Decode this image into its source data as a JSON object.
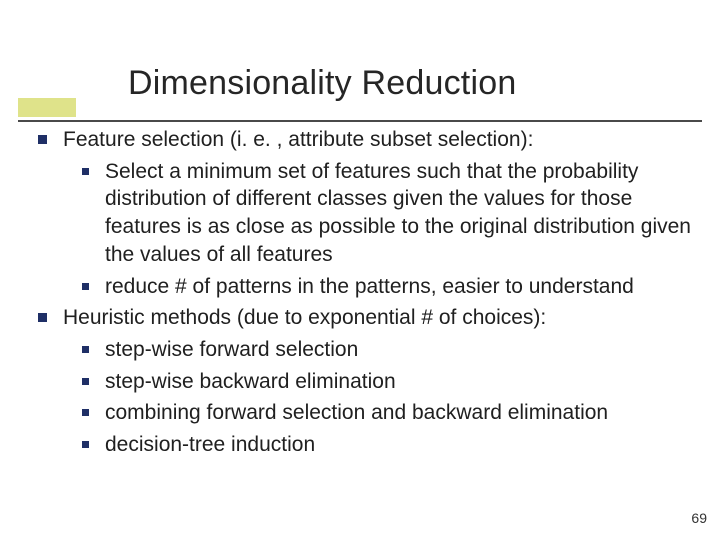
{
  "slide": {
    "title": "Dimensionality Reduction",
    "page_number": "69",
    "items": [
      {
        "text": "Feature selection (i. e. , attribute subset selection):",
        "sub": [
          "Select a minimum set of features such that the probability distribution of different classes given the values for those features is as close as possible to the original distribution given the values of all features",
          "reduce # of patterns in the patterns, easier to understand"
        ]
      },
      {
        "text": "Heuristic methods (due to exponential # of choices):",
        "sub": [
          "step-wise forward selection",
          "step-wise backward elimination",
          "combining forward selection and backward elimination",
          "decision-tree induction"
        ]
      }
    ]
  }
}
